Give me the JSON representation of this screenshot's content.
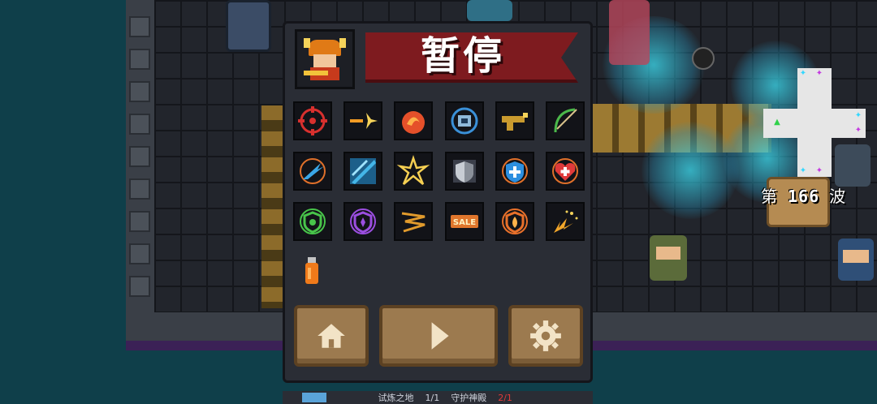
{
  "pause_menu": {
    "title": "暂停",
    "buffs": [
      {
        "icon": "crosshair-icon",
        "color": "#d8302e"
      },
      {
        "icon": "bullet-spark-icon",
        "color": "#f29b24"
      },
      {
        "icon": "fire-swirl-icon",
        "color": "#e5502a"
      },
      {
        "icon": "blue-chip-icon",
        "color": "#3a90d8"
      },
      {
        "icon": "golden-gun-icon",
        "color": "#c99a2e"
      },
      {
        "icon": "green-bow-icon",
        "color": "#4bb84a"
      },
      {
        "icon": "ice-arrow-icon",
        "color": "#3aa7e8"
      },
      {
        "icon": "blue-blade-icon",
        "color": "#44b6e8"
      },
      {
        "icon": "lightning-burst-icon",
        "color": "#f5cf52"
      },
      {
        "icon": "silver-shield-icon",
        "color": "#c8cdd4"
      },
      {
        "icon": "blue-health-shield-icon",
        "color": "#2c8fe0"
      },
      {
        "icon": "red-heart-icon",
        "color": "#e03a3a"
      },
      {
        "icon": "green-shield-icon",
        "color": "#48c44a"
      },
      {
        "icon": "purple-shield-icon",
        "color": "#9b4ee0"
      },
      {
        "icon": "speed-lines-icon",
        "color": "#e09a2c"
      },
      {
        "icon": "sale-tag-icon",
        "color": "#e0762c"
      },
      {
        "icon": "fire-shield-icon",
        "color": "#e8702a"
      },
      {
        "icon": "explosion-spark-icon",
        "color": "#f2a62a"
      }
    ],
    "extra_item": {
      "icon": "bottle-icon",
      "color": "#f07a1a"
    },
    "buttons": {
      "home": {
        "icon": "home-icon"
      },
      "resume": {
        "icon": "play-icon"
      },
      "settings": {
        "icon": "gear-icon"
      }
    },
    "bottom_bar": [
      "试炼之地",
      "1/1",
      "守护神殿",
      "2/1"
    ]
  },
  "hud": {
    "wave_prefix": "第",
    "wave_number": "166",
    "wave_suffix": "波"
  },
  "colors": {
    "panel_bg": "#2a2d35",
    "banner_red": "#7e1b1f",
    "button_brown": "#9c7a4f",
    "outer_bg": "#0f3f4a"
  }
}
